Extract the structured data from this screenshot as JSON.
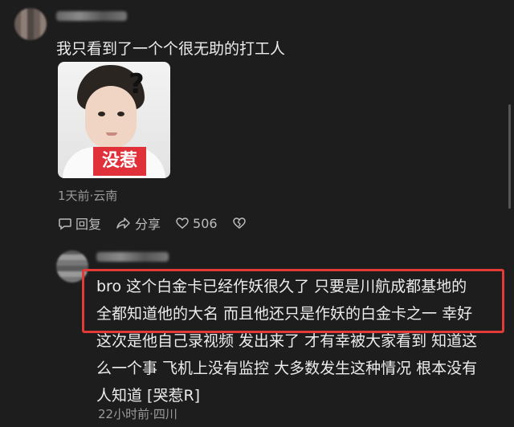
{
  "comment1": {
    "text": "我只看到了一个个很无助的打工人",
    "image_badge": "没惹",
    "image_symbol": "?",
    "meta": "1天前·云南",
    "actions": {
      "reply": "回复",
      "share": "分享",
      "like_count": "506"
    }
  },
  "comment2": {
    "lines": [
      "bro 这个白金卡已经作妖很久了  只要是川航成都基地的",
      "全都知道他的大名  而且他还只是作妖的白金卡之一  幸好",
      "这次是他自己录视频  发出来了  才有幸被大家看到  知道这",
      "么一个事  飞机上没有监控  大多数发生这种情况  根本没有",
      "人知道  [哭惹R]"
    ],
    "meta": "22小时前·四川"
  },
  "colors": {
    "background": "#1d1d1d",
    "highlight": "#e23a36",
    "badge": "#e0303a"
  }
}
